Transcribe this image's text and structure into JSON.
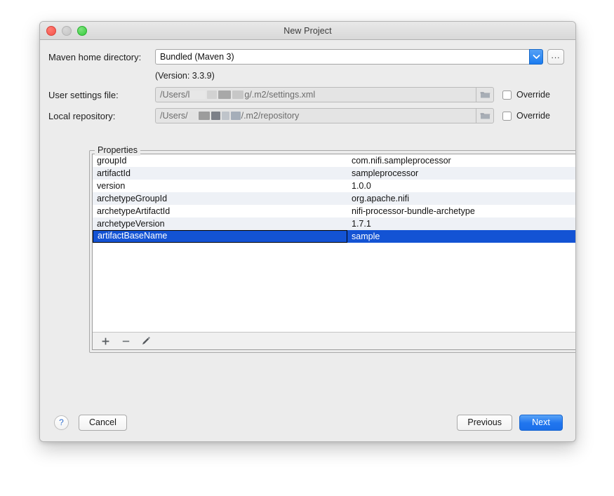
{
  "window": {
    "title": "New Project",
    "traffic_lights": [
      "close-red",
      "minimize-gray",
      "zoom-green"
    ]
  },
  "form": {
    "maven_home": {
      "label": "Maven home directory:",
      "value": "Bundled (Maven 3)",
      "browse_label": "...",
      "dropdown_icon": "chevron-down-icon"
    },
    "version_note": "(Version: 3.3.9)",
    "user_settings": {
      "label": "User settings file:",
      "value_prefix": "/Users/l",
      "value_suffix": "g/.m2/settings.xml",
      "folder_icon": "folder-icon",
      "override_label": "Override",
      "override_checked": false
    },
    "local_repository": {
      "label": "Local repository:",
      "value_prefix": "/Users/",
      "value_suffix": "/.m2/repository",
      "folder_icon": "folder-icon",
      "override_label": "Override",
      "override_checked": false
    }
  },
  "properties": {
    "title": "Properties",
    "rows": [
      {
        "name": "groupId",
        "value": "com.nifi.sampleprocessor",
        "selected": false
      },
      {
        "name": "artifactId",
        "value": "sampleprocessor",
        "selected": false
      },
      {
        "name": "version",
        "value": "1.0.0",
        "selected": false
      },
      {
        "name": "archetypeGroupId",
        "value": "org.apache.nifi",
        "selected": false
      },
      {
        "name": "archetypeArtifactId",
        "value": "nifi-processor-bundle-archetype",
        "selected": false
      },
      {
        "name": "archetypeVersion",
        "value": "1.7.1",
        "selected": false
      },
      {
        "name": "artifactBaseName",
        "value": "sample",
        "selected": true
      }
    ],
    "toolbar": [
      {
        "icon": "plus-icon",
        "label": "+"
      },
      {
        "icon": "minus-icon",
        "label": "−"
      },
      {
        "icon": "pencil-icon",
        "label": "edit"
      }
    ]
  },
  "footer": {
    "help_label": "?",
    "cancel_label": "Cancel",
    "previous_label": "Previous",
    "next_label": "Next"
  },
  "colors": {
    "accent_blue": "#1a76ef",
    "selection_blue": "#1353d4",
    "window_bg": "#ececec",
    "row_alt": "#eef1f6"
  }
}
